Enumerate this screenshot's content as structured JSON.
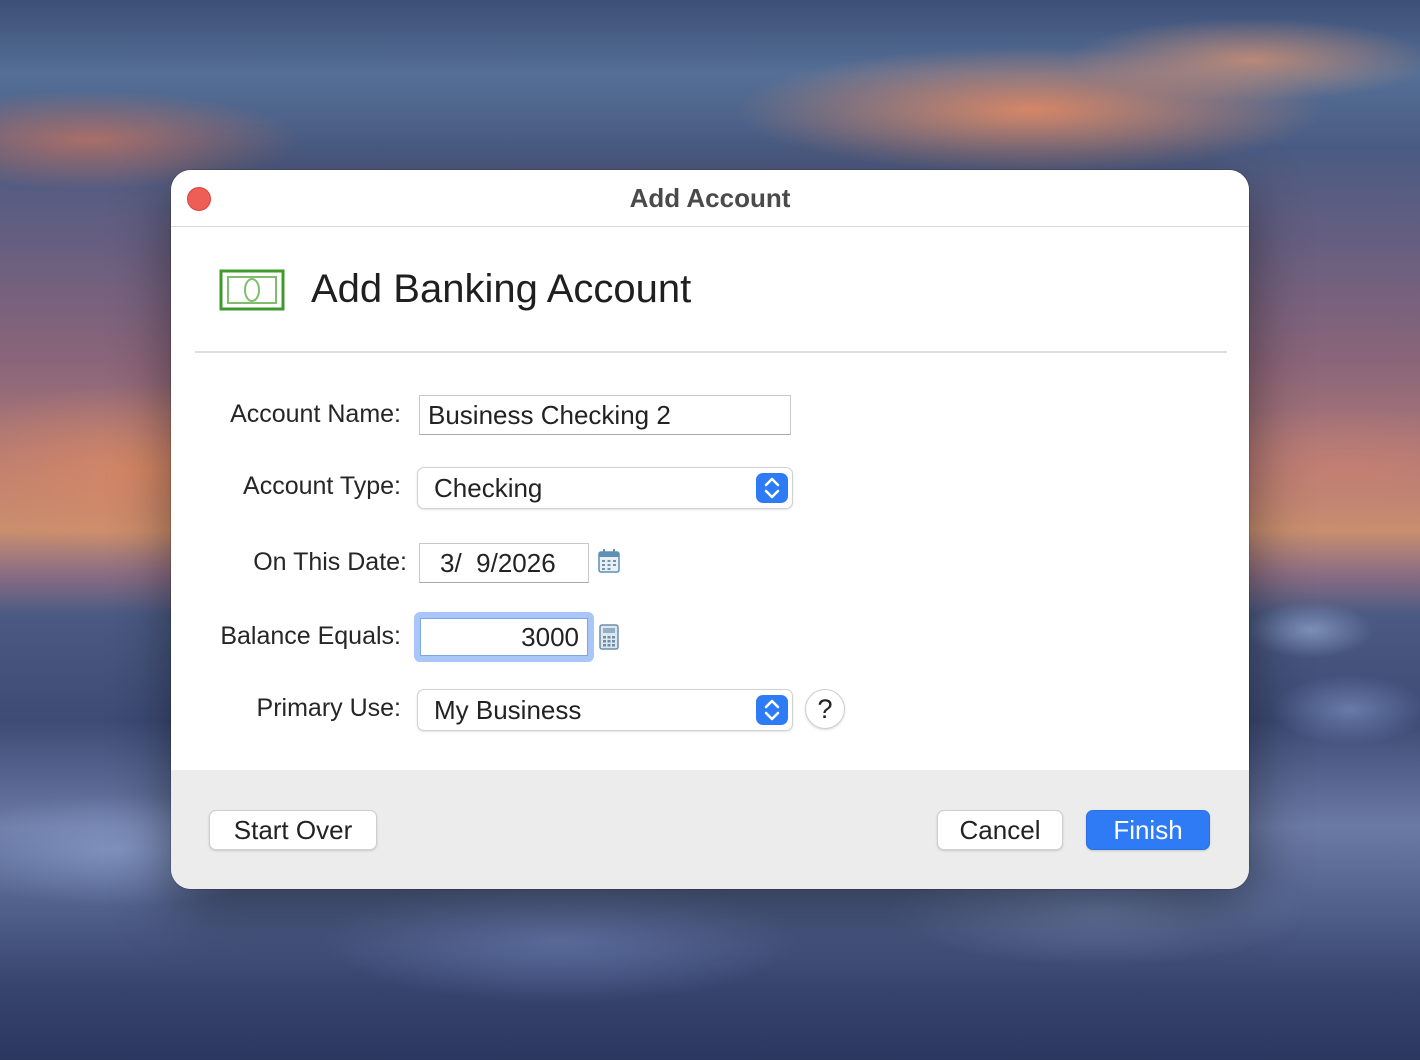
{
  "window": {
    "title": "Add Account"
  },
  "header": {
    "icon": "banknote-icon",
    "heading": "Add Banking Account"
  },
  "form": {
    "account_name": {
      "label": "Account Name:",
      "value": "Business Checking 2"
    },
    "account_type": {
      "label": "Account Type:",
      "value": "Checking"
    },
    "date": {
      "label": "On This Date:",
      "value": "3/  9/2026",
      "icon": "calendar-icon"
    },
    "balance": {
      "label": "Balance Equals:",
      "value": "3000",
      "icon": "calculator-icon"
    },
    "primary_use": {
      "label": "Primary Use:",
      "value": "My Business",
      "help": "?"
    }
  },
  "footer": {
    "start_over": "Start Over",
    "cancel": "Cancel",
    "finish": "Finish"
  },
  "colors": {
    "accent": "#2f7bf5",
    "close": "#ee5e57",
    "icon_green": "#3f9a2e"
  }
}
